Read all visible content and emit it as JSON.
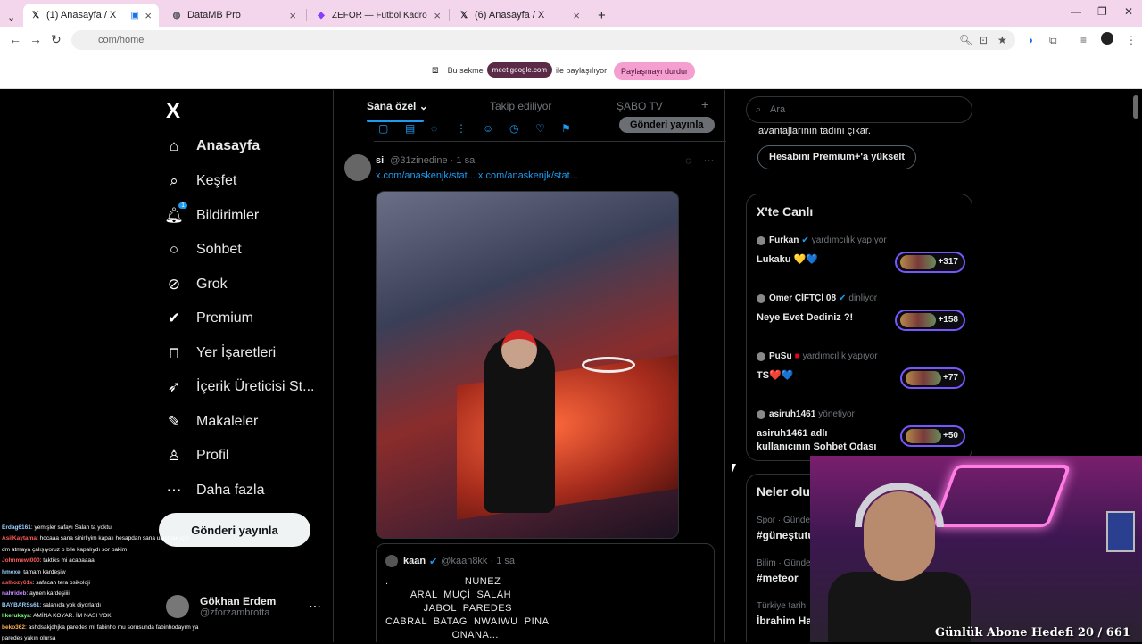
{
  "browser": {
    "tabs": [
      {
        "title": "(1) Anasayfa / X",
        "icon": "x-logo-icon",
        "active": true
      },
      {
        "title": "DataMB Pro",
        "icon": "globe-icon",
        "active": false
      },
      {
        "title": "ZEFOR — Futbol Kadro Planlam",
        "icon": "zefor-icon",
        "active": false
      },
      {
        "title": "(6) Anasayfa / X",
        "icon": "x-logo-icon",
        "active": false
      }
    ],
    "new_tab": "+",
    "url": "com/home"
  },
  "share_banner": {
    "prefix": "Bu sekme",
    "host": "meet.google.com",
    "suffix": "ile paylaşılıyor",
    "stop_label": "Paylaşmayı durdur"
  },
  "sidebar": {
    "logo": "X",
    "items": [
      {
        "label": "Anasayfa",
        "icon": "home-icon"
      },
      {
        "label": "Keşfet",
        "icon": "search-icon"
      },
      {
        "label": "Bildirimler",
        "icon": "bell-icon",
        "badge": "1"
      },
      {
        "label": "Sohbet",
        "icon": "chat-icon"
      },
      {
        "label": "Grok",
        "icon": "grok-icon"
      },
      {
        "label": "Premium",
        "icon": "premium-icon"
      },
      {
        "label": "Yer İşaretleri",
        "icon": "bookmark-icon"
      },
      {
        "label": "İçerik Üreticisi St...",
        "icon": "rocket-icon"
      },
      {
        "label": "Makaleler",
        "icon": "article-icon"
      },
      {
        "label": "Profil",
        "icon": "profile-icon"
      },
      {
        "label": "Daha fazla",
        "icon": "more-circle-icon"
      }
    ],
    "post_button": "Gönderi yayınla",
    "account": {
      "name": "Gökhan Erdem",
      "handle": "@zforzambrotta"
    }
  },
  "feed": {
    "tabs": [
      "Sana özel",
      "Takip ediliyor",
      "ŞABO TV"
    ],
    "add_tab": "+",
    "compose_post_label": "Gönderi yayınla",
    "tweet": {
      "name": "si",
      "handle": "@31zinedine",
      "time": "1 sa",
      "links": "x.com/anaskenjk/stat... x.com/anaskenjk/stat..."
    },
    "quote": {
      "name": "kaan",
      "handle": "@kaan8kk",
      "time": "1 sa",
      "lines": [
        ".                        NUNEZ",
        "        ARAL  MUÇİ  SALAH",
        "            JABOL  PAREDES",
        "CABRAL  BATAG  NWAIWU  PINA",
        "                     ONANA..."
      ]
    }
  },
  "right": {
    "search_placeholder": "Ara",
    "premium_text": "avantajlarının tadını çıkar.",
    "premium_button": "Hesabını Premium+'a yükselt",
    "live_title": "X'te Canlı",
    "live": [
      {
        "host": "Furkan",
        "role": "yardımcılık yapıyor",
        "title": "Lukaku 💛💙",
        "count": "+317"
      },
      {
        "host": "Ömer ÇİFTÇİ 08",
        "role": "dinliyor",
        "title": "Neye Evet Dediniz ?!",
        "count": "+158"
      },
      {
        "host": "PuSu",
        "role": "yardımcılık yapıyor",
        "title": "TS❤️💙",
        "count": "+77"
      },
      {
        "host": "asiruh1461",
        "role": "yönetiyor",
        "title": "asiruh1461 adlı kullanıcının Sohbet Odası",
        "count": "+50"
      }
    ],
    "trends_title": "Neler olu",
    "trends": [
      {
        "cat": "Spor · Günde",
        "tag": "#güneştutu"
      },
      {
        "cat": "Bilim · Günde",
        "tag": "#meteor"
      },
      {
        "cat": "Türkiye tarih",
        "tag": "İbrahim Hal"
      }
    ]
  },
  "stream": {
    "goal_text": "Günlük Abone Hedefi 20 / 661",
    "chat": [
      {
        "user": "Erdag6161",
        "color": "#9ad0ff",
        "msg": ": yemişler safayı Salah ta yoktu"
      },
      {
        "user": "AsilKaytama",
        "color": "#ff5c5c",
        "msg": ": hocaaa sana sinirliyim kapalı hesapdan sana ulaşmak için"
      },
      {
        "user": "",
        "color": "#ffffff",
        "msg": "dm atmaya çalışıyoruz o bile kapalıydı sor bakim"
      },
      {
        "user": "Johnmewi000",
        "color": "#ff5c5c",
        "msg": ": taktiks mi acabaaaa"
      },
      {
        "user": "hmexe",
        "color": "#9ad0ff",
        "msg": ": tamam kardeşiw"
      },
      {
        "user": "aslhozy61x",
        "color": "#ff5c5c",
        "msg": ": safacan tera psikoloji"
      },
      {
        "user": "nahrideb",
        "color": "#c58cff",
        "msg": ": aynen kardeşiiii"
      },
      {
        "user": "BAYBARSs61",
        "color": "#9ad0ff",
        "msg": ": salahıda yok diyorlardı"
      },
      {
        "user": "llkerukaya",
        "color": "#7cff7c",
        "msg": ": AMİNA KOYAR. İM NASI YOK"
      },
      {
        "user": "beko362",
        "color": "#ffb24c",
        "msg": ": ashdsakjdhjka paredes mi fabinho mu sorusunda fabinhodayım ya"
      },
      {
        "user": "",
        "color": "#ffffff",
        "msg": "paredes yakın olursa"
      }
    ]
  }
}
